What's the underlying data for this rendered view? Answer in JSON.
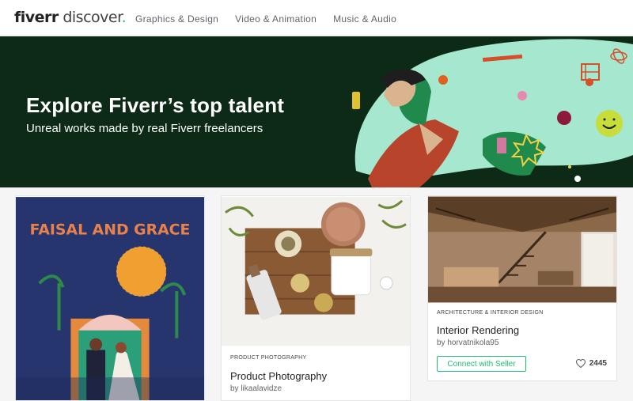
{
  "header": {
    "logo_brand": "fiverr",
    "logo_word": " discover",
    "logo_dot": ".",
    "nav": [
      "Graphics & Design",
      "Video & Animation",
      "Music & Audio"
    ]
  },
  "hero": {
    "title": "Explore Fiverr’s top talent",
    "subtitle": "Unreal works made by real Fiverr freelancers"
  },
  "cards": [
    {
      "poster_text": "FAISAL AND GRACE"
    },
    {
      "category": "PRODUCT PHOTOGRAPHY",
      "title": "Product Photography",
      "seller": "by likaalavidze"
    },
    {
      "category": "ARCHITECTURE & INTERIOR DESIGN",
      "title": "Interior Rendering",
      "seller": "by horvatnikola95",
      "button": "Connect with Seller",
      "likes": "2445"
    }
  ],
  "colors": {
    "brand_green": "#1dbf73",
    "hero_bg": "#0d2a16",
    "art_mint": "#a6e8cf"
  }
}
